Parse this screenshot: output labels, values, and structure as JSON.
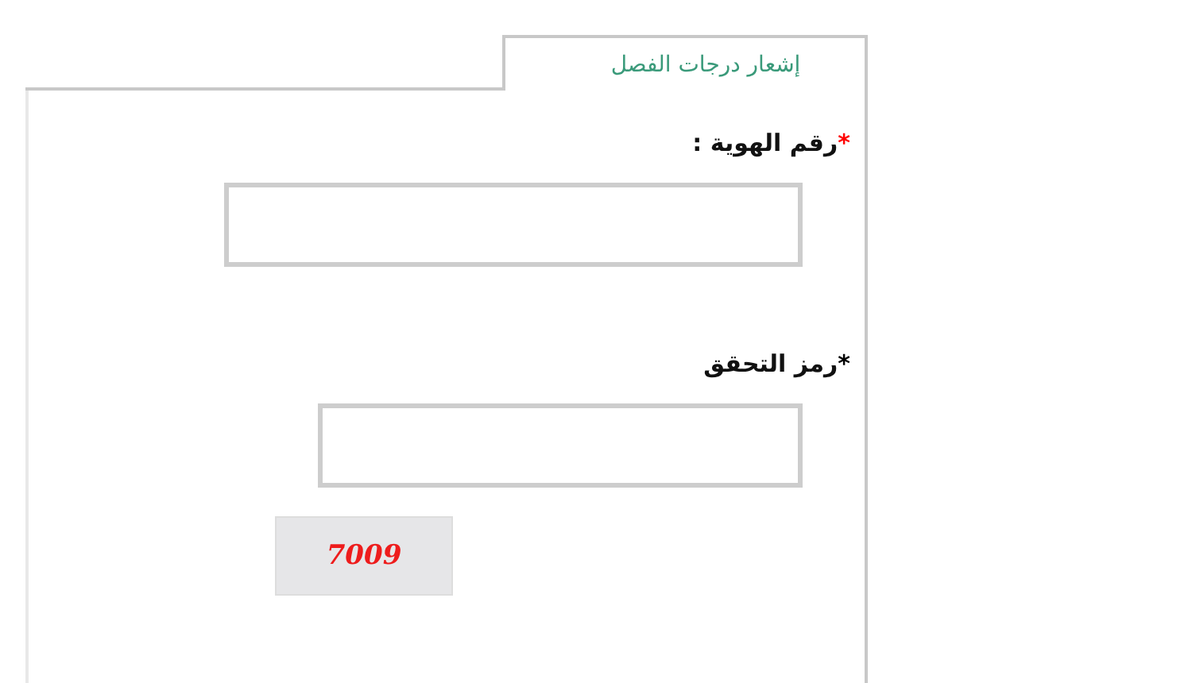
{
  "tab": {
    "label": "إشعار درجات الفصل",
    "selected": true
  },
  "fields": [
    {
      "label": "رقم الهوية :",
      "asterisk": "*",
      "color": "#ff0000",
      "kind": "wide"
    },
    {
      "label": "رمز التحقق",
      "asterisk": "*",
      "color": "#000000",
      "kind": "narrow"
    }
  ],
  "captcha": {
    "code": "7009"
  }
}
